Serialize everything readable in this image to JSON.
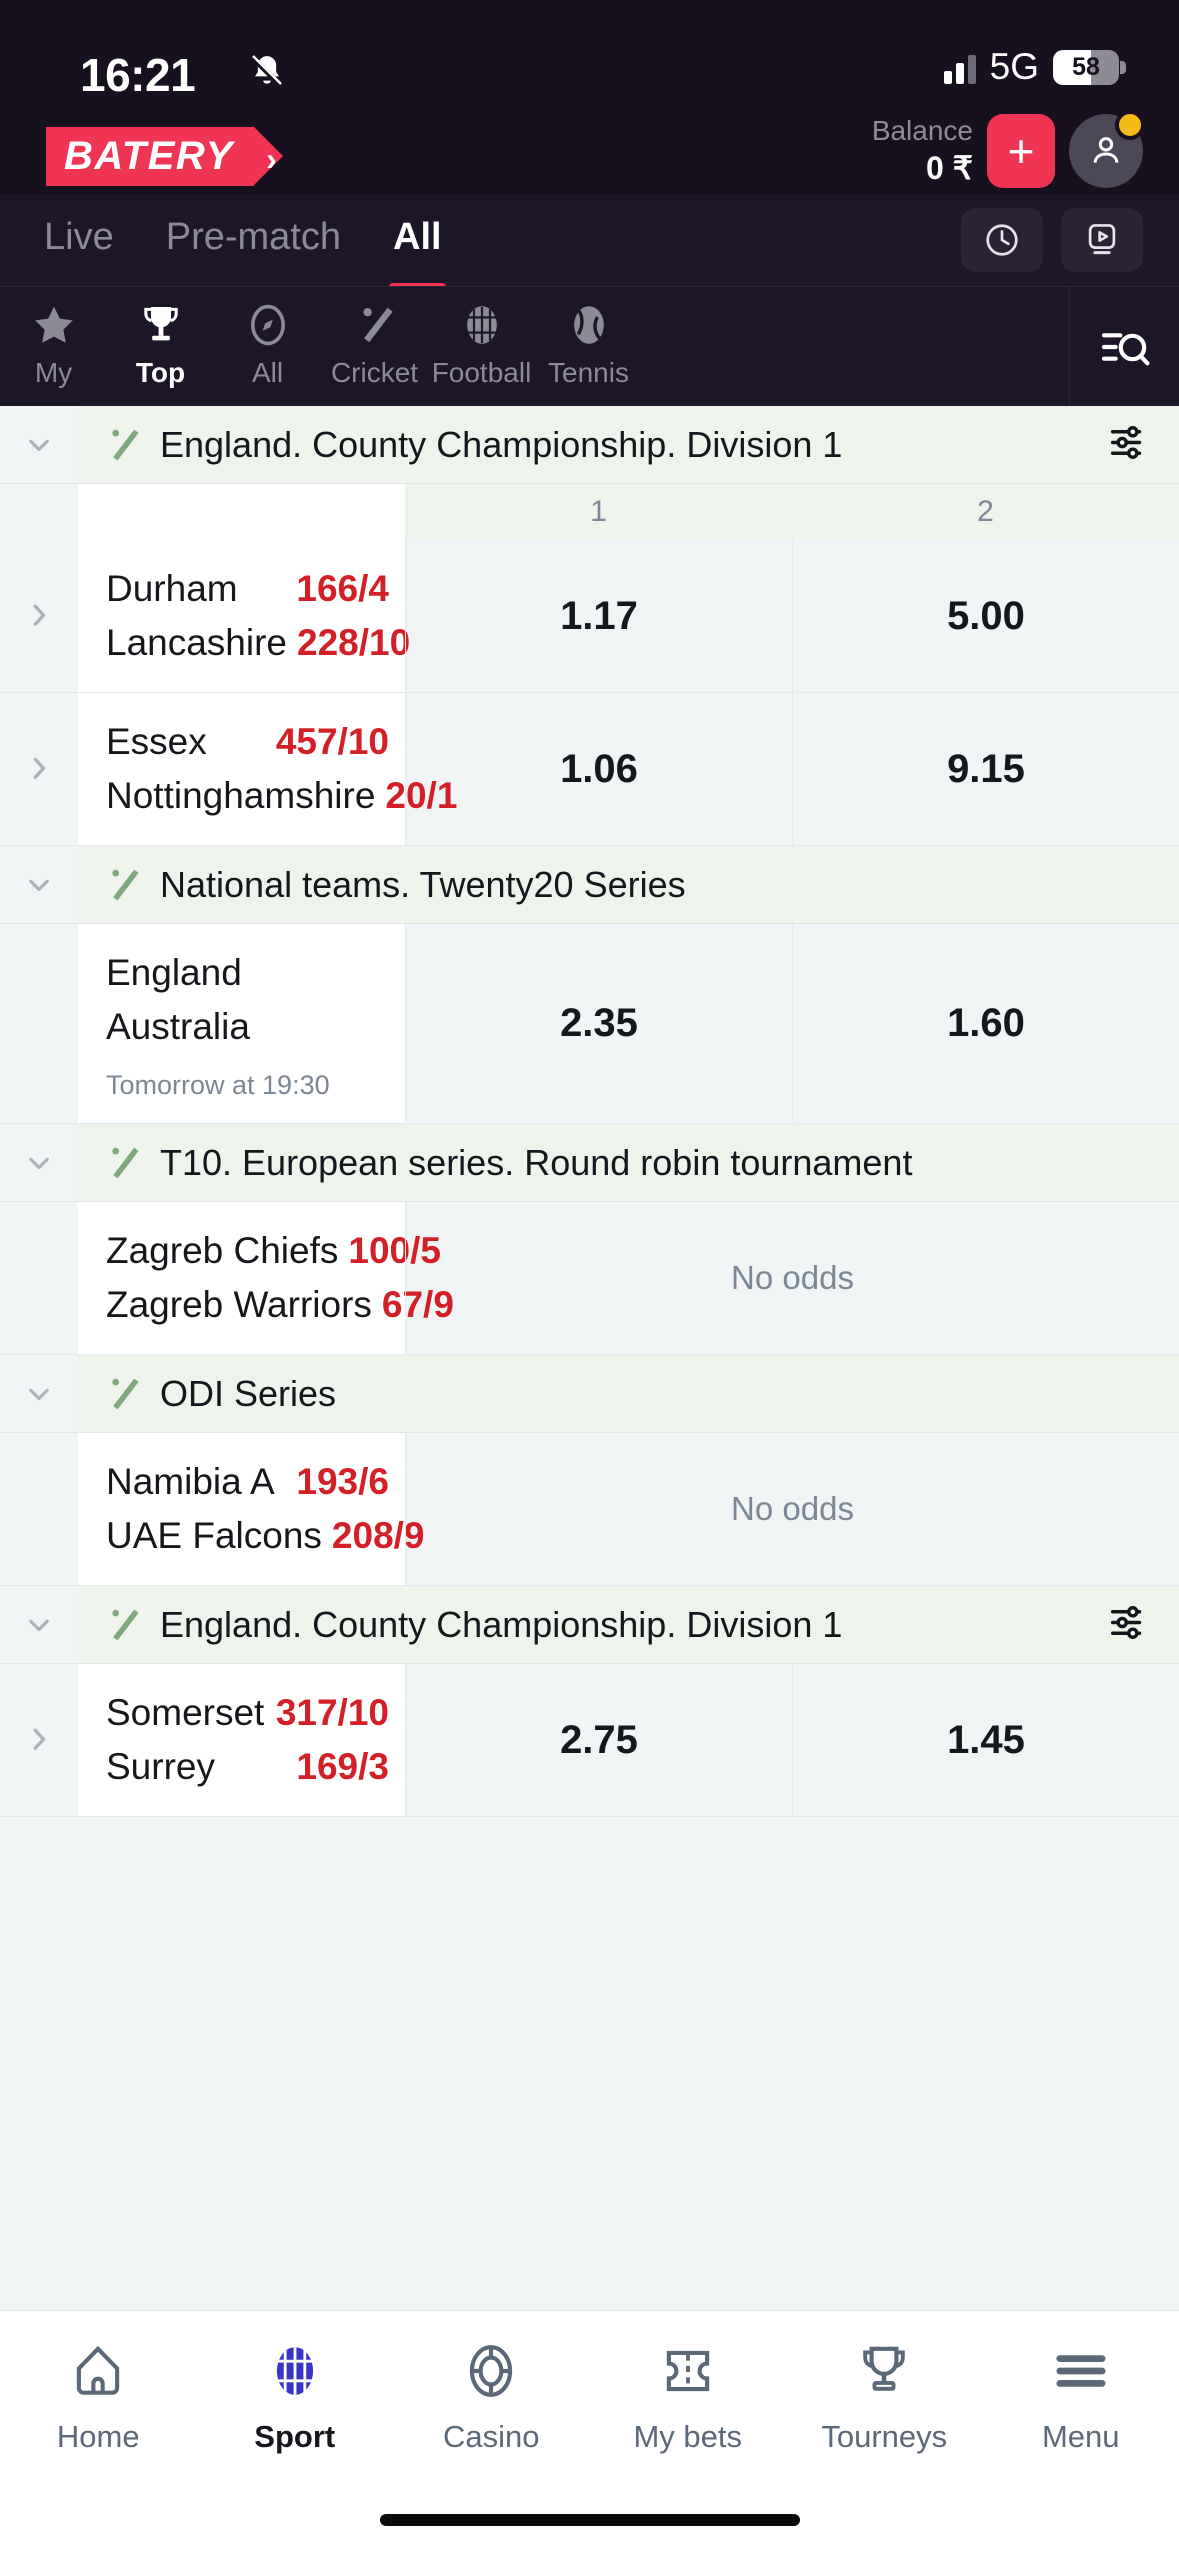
{
  "status_bar": {
    "time": "16:21",
    "silent_icon": "bell-slash-icon",
    "network": "5G",
    "battery_percent": "58",
    "battery_level": 58
  },
  "header": {
    "logo_text": "BATERY",
    "balance_label": "Balance",
    "balance_value": "0 ₹",
    "deposit_label": "+",
    "account_icon": "user-icon",
    "notification_dot_color": "#f5bb19",
    "brand_color": "#ef3454"
  },
  "segment_tabs": {
    "items": [
      {
        "label": "Live",
        "active": false
      },
      {
        "label": "Pre-match",
        "active": false
      },
      {
        "label": "All",
        "active": true
      }
    ],
    "actions": [
      {
        "icon": "clock-icon",
        "name": "results-history"
      },
      {
        "icon": "stream-icon",
        "name": "live-stream"
      }
    ]
  },
  "sports": {
    "items": [
      {
        "label": "My",
        "icon": "star-icon",
        "active": false
      },
      {
        "label": "Top",
        "icon": "trophy-icon",
        "active": true
      },
      {
        "label": "All",
        "icon": "compass-icon",
        "active": false
      },
      {
        "label": "Cricket",
        "icon": "cricket-icon",
        "active": false
      },
      {
        "label": "Football",
        "icon": "football-icon",
        "active": false
      },
      {
        "label": "Tennis",
        "icon": "tennis-icon",
        "active": false
      }
    ],
    "search_icon": "search-filter-icon"
  },
  "odds_headers": {
    "col1": "1",
    "col2": "2"
  },
  "sections": [
    {
      "id": "england-county-1",
      "title": "England. County Championship. Division 1",
      "has_filter": true,
      "show_odds_header": true,
      "matches": [
        {
          "expandable": true,
          "home": "Durham",
          "home_score": "166/4",
          "away": "Lancashire",
          "away_score": "228/10",
          "time": "",
          "odds": [
            "1.17",
            "5.00"
          ],
          "no_odds": ""
        },
        {
          "expandable": true,
          "home": "Essex",
          "home_score": "457/10",
          "away": "Nottinghamshire",
          "away_score": "20/1",
          "time": "",
          "odds": [
            "1.06",
            "9.15"
          ],
          "no_odds": ""
        }
      ]
    },
    {
      "id": "national-t20",
      "title": "National teams. Twenty20 Series",
      "has_filter": false,
      "show_odds_header": false,
      "matches": [
        {
          "expandable": false,
          "home": "England",
          "home_score": "",
          "away": "Australia",
          "away_score": "",
          "time": "Tomorrow at 19:30",
          "odds": [
            "2.35",
            "1.60"
          ],
          "no_odds": ""
        }
      ]
    },
    {
      "id": "t10-european",
      "title": "T10. European series. Round robin tournament",
      "has_filter": false,
      "show_odds_header": false,
      "matches": [
        {
          "expandable": false,
          "home": "Zagreb Chiefs",
          "home_score": "100/5",
          "away": "Zagreb Warriors",
          "away_score": "67/9",
          "time": "",
          "odds": [],
          "no_odds": "No odds"
        }
      ]
    },
    {
      "id": "odi-series",
      "title": "ODI Series",
      "has_filter": false,
      "show_odds_header": false,
      "matches": [
        {
          "expandable": false,
          "home": "Namibia A",
          "home_score": "193/6",
          "away": "UAE Falcons",
          "away_score": "208/9",
          "time": "",
          "odds": [],
          "no_odds": "No odds"
        }
      ]
    },
    {
      "id": "england-county-2",
      "title": "England. County Championship. Division 1",
      "has_filter": true,
      "show_odds_header": false,
      "matches": [
        {
          "expandable": true,
          "home": "Somerset",
          "home_score": "317/10",
          "away": "Surrey",
          "away_score": "169/3",
          "time": "",
          "odds": [
            "2.75",
            "1.45"
          ],
          "no_odds": ""
        }
      ]
    }
  ],
  "bottom_nav": {
    "items": [
      {
        "label": "Home",
        "icon": "home-icon",
        "active": false
      },
      {
        "label": "Sport",
        "icon": "football-icon",
        "active": true
      },
      {
        "label": "Casino",
        "icon": "chip-icon",
        "active": false
      },
      {
        "label": "My bets",
        "icon": "ticket-icon",
        "active": false
      },
      {
        "label": "Tourneys",
        "icon": "trophy-icon",
        "active": false
      },
      {
        "label": "Menu",
        "icon": "hamburger-icon",
        "active": false
      }
    ],
    "active_color": "#3b35c4"
  }
}
